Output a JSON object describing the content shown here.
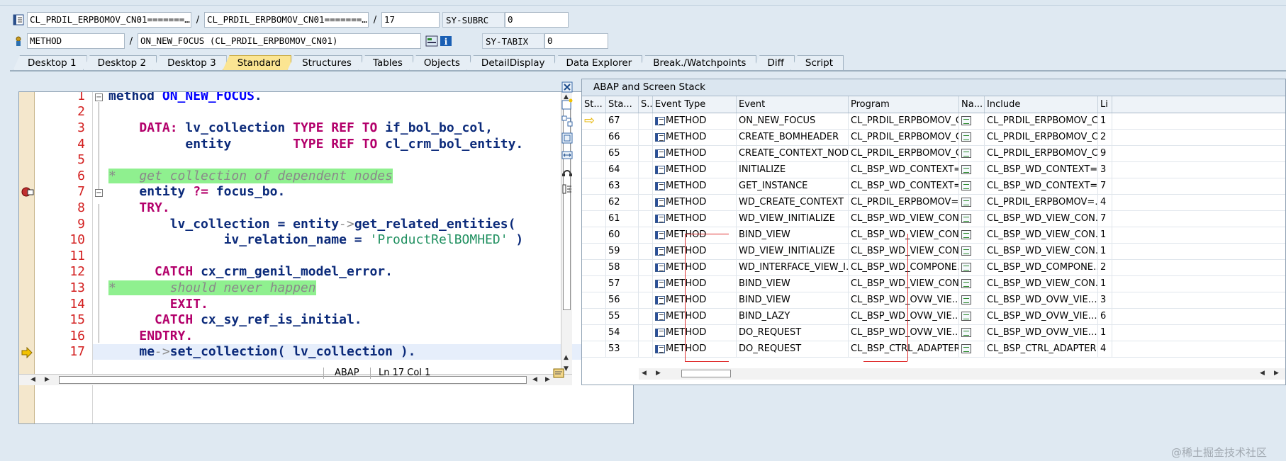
{
  "header": {
    "row1": {
      "field1": "CL_PRDIL_ERPBOMOV_CN01=======…",
      "field2": "CL_PRDIL_ERPBOMOV_CN01=======…",
      "field3": "17",
      "label": "SY-SUBRC",
      "value": "0"
    },
    "row2": {
      "field1": "METHOD",
      "field2": "ON_NEW_FOCUS (CL_PRDIL_ERPBOMOV_CN01)",
      "label": "SY-TABIX",
      "value": "0"
    },
    "slash": "/"
  },
  "tabs": [
    "Desktop 1",
    "Desktop 2",
    "Desktop 3",
    "Standard",
    "Structures",
    "Tables",
    "Objects",
    "DetailDisplay",
    "Data Explorer",
    "Break./Watchpoints",
    "Diff",
    "Script"
  ],
  "active_tab": "Standard",
  "editor": {
    "line_numbers": [
      "1",
      "2",
      "3",
      "4",
      "5",
      "6",
      "7",
      "8",
      "9",
      "10",
      "11",
      "12",
      "13",
      "14",
      "15",
      "16",
      "17"
    ],
    "status": {
      "lang": "ABAP",
      "position": "Ln  17 Col   1"
    }
  },
  "stack": {
    "title": "ABAP and Screen Stack",
    "columns": [
      "St...",
      "Sta...",
      "S..",
      "Event Type",
      "Event",
      "Program",
      "Na...",
      "Include",
      "Li"
    ],
    "rows": [
      {
        "level": "67",
        "type": "METHOD",
        "event": "ON_NEW_FOCUS",
        "program": "CL_PRDIL_ERPBOMOV_C…",
        "include": "CL_PRDIL_ERPBOMOV_C…",
        "line": "1",
        "current": true
      },
      {
        "level": "66",
        "type": "METHOD",
        "event": "CREATE_BOMHEADER",
        "program": "CL_PRDIL_ERPBOMOV_C…",
        "include": "CL_PRDIL_ERPBOMOV_C…",
        "line": "2"
      },
      {
        "level": "65",
        "type": "METHOD",
        "event": "CREATE_CONTEXT_NOD…",
        "program": "CL_PRDIL_ERPBOMOV_C…",
        "include": "CL_PRDIL_ERPBOMOV_C…",
        "line": "9"
      },
      {
        "level": "64",
        "type": "METHOD",
        "event": "INITIALIZE",
        "program": "CL_BSP_WD_CONTEXT=…",
        "include": "CL_BSP_WD_CONTEXT=…",
        "line": "3"
      },
      {
        "level": "63",
        "type": "METHOD",
        "event": "GET_INSTANCE",
        "program": "CL_BSP_WD_CONTEXT=…",
        "include": "CL_BSP_WD_CONTEXT=…",
        "line": "7"
      },
      {
        "level": "62",
        "type": "METHOD",
        "event": "WD_CREATE_CONTEXT",
        "program": "CL_PRDIL_ERPBOMOV=…",
        "include": "CL_PRDIL_ERPBOMOV=…",
        "line": "4"
      },
      {
        "level": "61",
        "type": "METHOD",
        "event": "WD_VIEW_INITIALIZE",
        "program": "CL_BSP_WD_VIEW_CON…",
        "include": "CL_BSP_WD_VIEW_CON…",
        "line": "7"
      },
      {
        "level": "60",
        "type": "METHOD",
        "event": "BIND_VIEW",
        "program": "CL_BSP_WD_VIEW_CON…",
        "include": "CL_BSP_WD_VIEW_CON…",
        "line": "1"
      },
      {
        "level": "59",
        "type": "METHOD",
        "event": "WD_VIEW_INITIALIZE",
        "program": "CL_BSP_WD_VIEW_CON…",
        "include": "CL_BSP_WD_VIEW_CON…",
        "line": "1"
      },
      {
        "level": "58",
        "type": "METHOD",
        "event": "WD_INTERFACE_VIEW_I…",
        "program": "CL_BSP_WD_COMPONE…",
        "include": "CL_BSP_WD_COMPONE…",
        "line": "2"
      },
      {
        "level": "57",
        "type": "METHOD",
        "event": "BIND_VIEW",
        "program": "CL_BSP_WD_VIEW_CON…",
        "include": "CL_BSP_WD_VIEW_CON…",
        "line": "1"
      },
      {
        "level": "56",
        "type": "METHOD",
        "event": "BIND_VIEW",
        "program": "CL_BSP_WD_OVW_VIE…",
        "include": "CL_BSP_WD_OVW_VIE…",
        "line": "3"
      },
      {
        "level": "55",
        "type": "METHOD",
        "event": "BIND_LAZY",
        "program": "CL_BSP_WD_OVW_VIE…",
        "include": "CL_BSP_WD_OVW_VIE…",
        "line": "6"
      },
      {
        "level": "54",
        "type": "METHOD",
        "event": "DO_REQUEST",
        "program": "CL_BSP_WD_OVW_VIE…",
        "include": "CL_BSP_WD_OVW_VIE…",
        "line": "1"
      },
      {
        "level": "53",
        "type": "METHOD",
        "event": "DO_REQUEST",
        "program": "CL_BSP_CTRL_ADAPTER…",
        "include": "CL_BSP_CTRL_ADAPTER…",
        "line": "4"
      }
    ]
  },
  "watermark": "@稀土掘金技术社区",
  "colors": {
    "active_tab": "#fbe592",
    "comment_bg": "#8ff08f",
    "keyword": "#b3006b",
    "line_number": "#d32020"
  }
}
